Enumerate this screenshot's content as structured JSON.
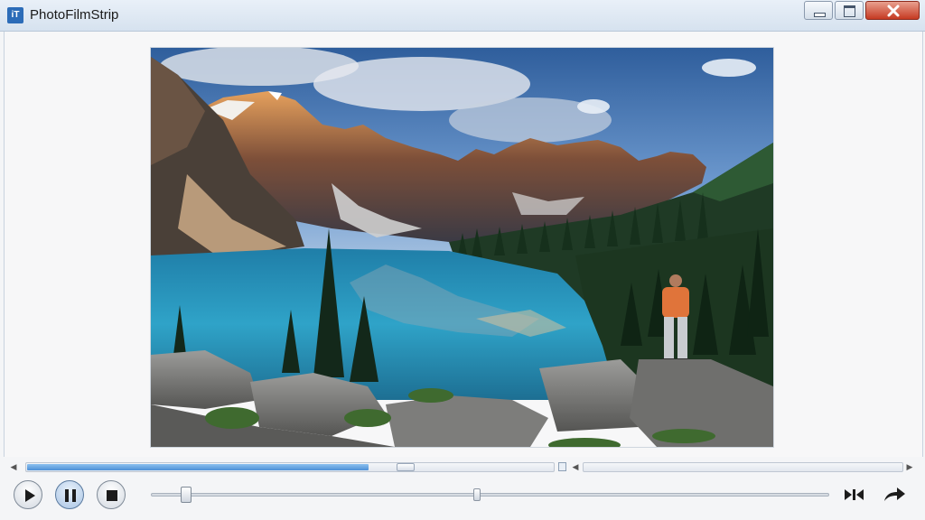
{
  "window": {
    "title": "PhotoFilmStrip",
    "app_icon_text": "iT"
  },
  "preview": {
    "image": "mountain-lake-photo"
  },
  "timeline": {
    "progress_fraction": 0.72
  },
  "playback": {
    "seek_position_fraction": 0.05,
    "marker_position_fraction": 0.48,
    "buttons": [
      "play",
      "pause",
      "stop"
    ],
    "active_button": "pause"
  },
  "icons": {
    "app": "app-icon",
    "minimize": "minimize-icon",
    "maximize": "maximize-icon",
    "close": "close-icon",
    "play": "play-icon",
    "pause": "pause-icon",
    "stop": "stop-icon",
    "skip": "skip-to-end-icon",
    "forward": "forward-arrow-icon"
  }
}
